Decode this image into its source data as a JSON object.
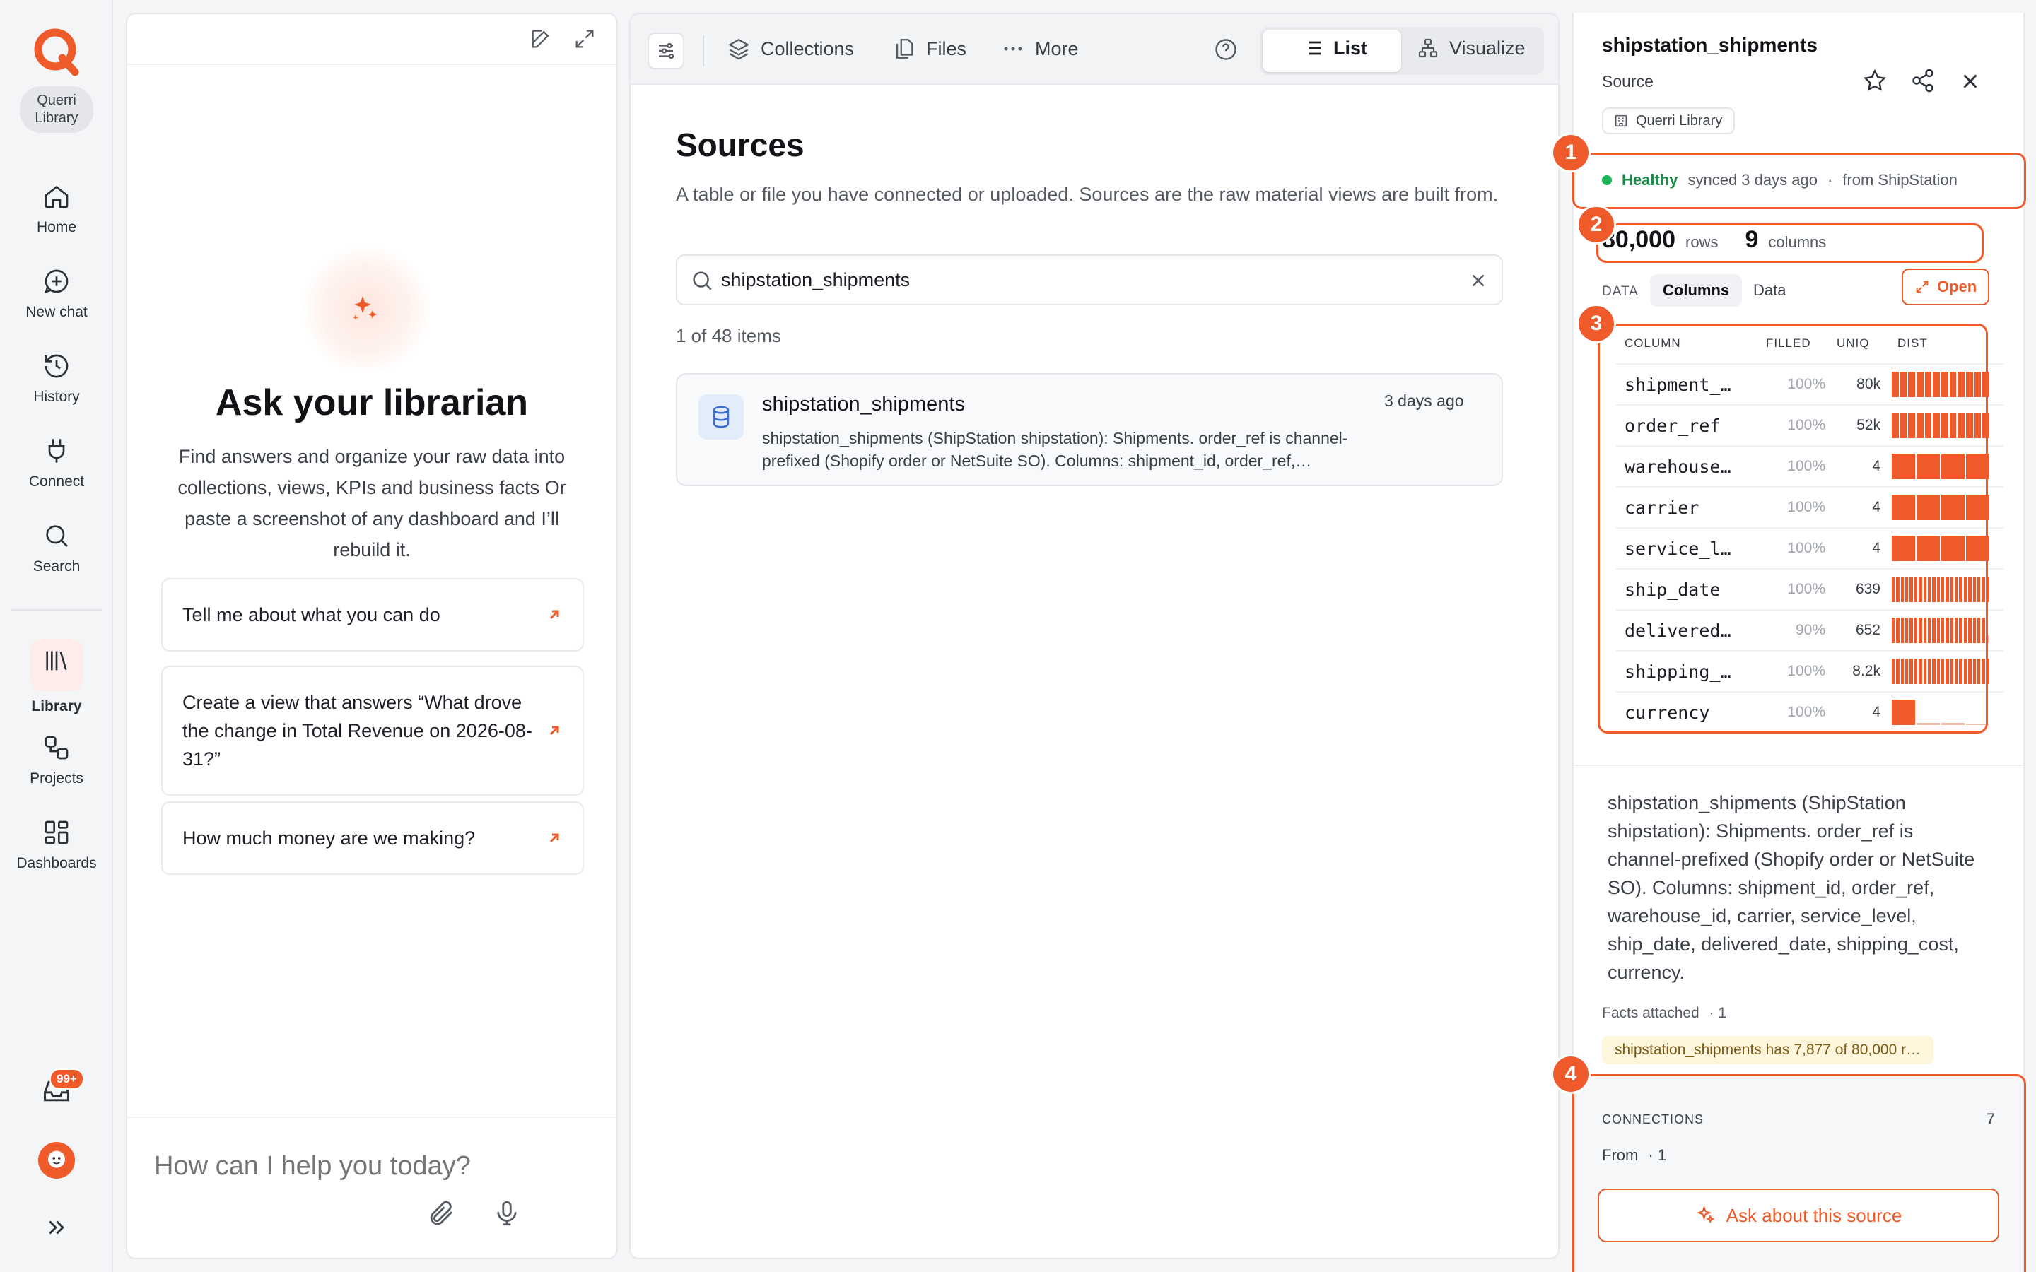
{
  "nav": {
    "workspace_label": "Querri Library",
    "items": [
      {
        "label": "Home",
        "icon": "home-icon"
      },
      {
        "label": "New chat",
        "icon": "new-chat-icon"
      },
      {
        "label": "History",
        "icon": "history-icon"
      },
      {
        "label": "Connect",
        "icon": "plug-icon"
      },
      {
        "label": "Search",
        "icon": "search-icon"
      },
      {
        "label": "Library",
        "icon": "library-icon",
        "active": true
      },
      {
        "label": "Projects",
        "icon": "projects-icon"
      },
      {
        "label": "Dashboards",
        "icon": "dashboards-icon"
      }
    ],
    "inbox_badge": "99+",
    "brand_color": "#ee5a2a"
  },
  "chat": {
    "title": "Ask your librarian",
    "description": "Find answers and organize your raw data into collections, views, KPIs and business facts Or paste a screenshot of any dashboard and I’ll rebuild it.",
    "suggestions": [
      "Tell me about what you can do",
      "Create a view that answers “What drove the change in Total Revenue on 2026-08-31?”",
      "How much money are we making?"
    ],
    "input_placeholder": "How can I help you today?"
  },
  "toolbar": {
    "collections": "Collections",
    "files": "Files",
    "more": "More",
    "list": "List",
    "visualize": "Visualize"
  },
  "sources": {
    "title": "Sources",
    "subtitle": "A table or file you have connected or uploaded. Sources are the raw material views are built from.",
    "search_value": "shipstation_shipments",
    "count_text": "1 of 48 items",
    "items": [
      {
        "name": "shipstation_shipments",
        "desc_line1": "shipstation_shipments (ShipStation shipstation): Shipments. order_ref is channel-",
        "desc_line2": "prefixed (Shopify order or NetSuite SO). Columns: shipment_id, order_ref,…",
        "time": "3 days ago"
      }
    ]
  },
  "detail": {
    "title": "shipstation_shipments",
    "type": "Source",
    "library_tag": "Querri Library",
    "health": "Healthy",
    "synced": "synced 3 days ago",
    "sep": "·",
    "from": "from ShipStation",
    "rows_value": "80,000",
    "rows_label": "rows",
    "cols_value": "9",
    "cols_label": "columns",
    "data_label": "DATA",
    "tab_columns": "Columns",
    "tab_data": "Data",
    "open_label": "Open",
    "table_headers": [
      "COLUMN",
      "FILLED",
      "UNIQ",
      "DIST"
    ],
    "columns": [
      {
        "name": "shipment_…",
        "filled": "100%",
        "uniq": "80k",
        "dist": "many"
      },
      {
        "name": "order_ref",
        "filled": "100%",
        "uniq": "52k",
        "dist": "many"
      },
      {
        "name": "warehouse…",
        "filled": "100%",
        "uniq": "4",
        "dist": "four"
      },
      {
        "name": "carrier",
        "filled": "100%",
        "uniq": "4",
        "dist": "four"
      },
      {
        "name": "service_l…",
        "filled": "100%",
        "uniq": "4",
        "dist": "four"
      },
      {
        "name": "ship_date",
        "filled": "100%",
        "uniq": "639",
        "dist": "dense"
      },
      {
        "name": "delivered…",
        "filled": "90%",
        "uniq": "652",
        "dist": "dense-tail"
      },
      {
        "name": "shipping_…",
        "filled": "100%",
        "uniq": "8.2k",
        "dist": "dense"
      },
      {
        "name": "currency",
        "filled": "100%",
        "uniq": "4",
        "dist": "skewed"
      }
    ],
    "description": "shipstation_shipments (ShipStation shipstation): Shipments. order_ref is channel-prefixed (Shopify order or NetSuite SO). Columns: shipment_id, order_ref, warehouse_id, carrier, service_level, ship_date, delivered_date, shipping_cost, currency.",
    "facts_label": "Facts attached",
    "facts_count": "· 1",
    "fact_chip": "shipstation_shipments has 7,877 of 80,000 r…",
    "connections_label": "CONNECTIONS",
    "connections_count": "7",
    "from_label": "From",
    "from_count": "· 1",
    "ask_button": "Ask about this source",
    "callouts": [
      "1",
      "2",
      "3",
      "4"
    ],
    "accent_color": "#ee5a2a",
    "health_color": "#1fb35a"
  }
}
